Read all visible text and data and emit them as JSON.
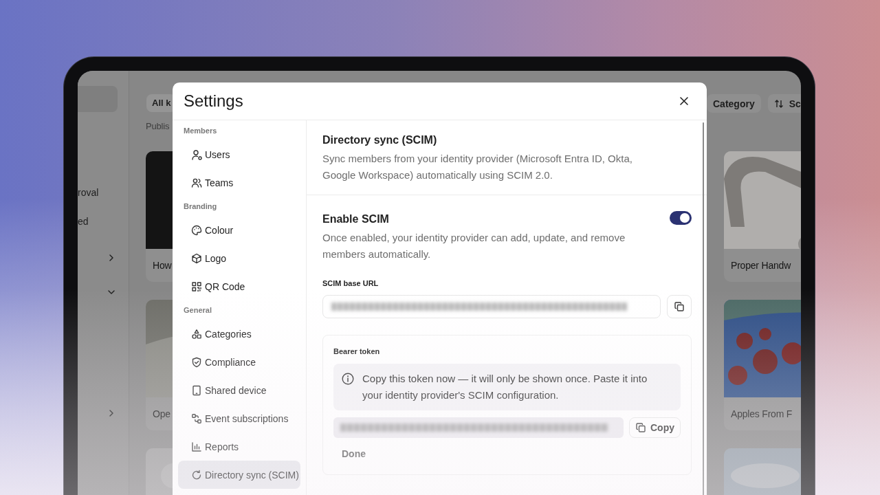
{
  "background_app": {
    "sidebar": {
      "items": [
        {
          "label": "roval"
        },
        {
          "label": "ed"
        }
      ]
    },
    "filter_chip": "All k",
    "subtitle": "Publis",
    "category_button": "Category",
    "sort_button": "Sc",
    "cards": [
      {
        "title": "How"
      },
      {
        "title": "Proper Handw"
      },
      {
        "title": "Ope"
      },
      {
        "title": "Apples From F"
      }
    ]
  },
  "dialog": {
    "title": "Settings",
    "nav": [
      {
        "heading": "Members",
        "items": [
          {
            "label": "Users",
            "selected": false
          },
          {
            "label": "Teams",
            "selected": false
          }
        ]
      },
      {
        "heading": "Branding",
        "items": [
          {
            "label": "Colour",
            "selected": false
          },
          {
            "label": "Logo",
            "selected": false
          },
          {
            "label": "QR Code",
            "selected": false
          }
        ]
      },
      {
        "heading": "General",
        "items": [
          {
            "label": "Categories",
            "selected": false
          },
          {
            "label": "Compliance",
            "selected": false
          },
          {
            "label": "Shared device",
            "selected": false
          },
          {
            "label": "Event subscriptions",
            "selected": false
          },
          {
            "label": "Reports",
            "selected": false
          },
          {
            "label": "Directory sync (SCIM)",
            "selected": true
          }
        ]
      }
    ],
    "section": {
      "title": "Directory sync (SCIM)",
      "description": "Sync members from your identity provider (Microsoft Entra ID, Okta, Google Workspace) automatically using SCIM 2.0."
    },
    "scim": {
      "label": "Enable SCIM",
      "on": true,
      "description": "Once enabled, your identity provider can add, update, and remove members automatically."
    },
    "base_url": {
      "label": "SCIM base URL"
    },
    "bearer": {
      "label": "Bearer token",
      "notice": "Copy this token now — it will only be shown once. Paste it into your identity provider's SCIM configuration.",
      "copy_button": "Copy",
      "done_button": "Done"
    }
  }
}
